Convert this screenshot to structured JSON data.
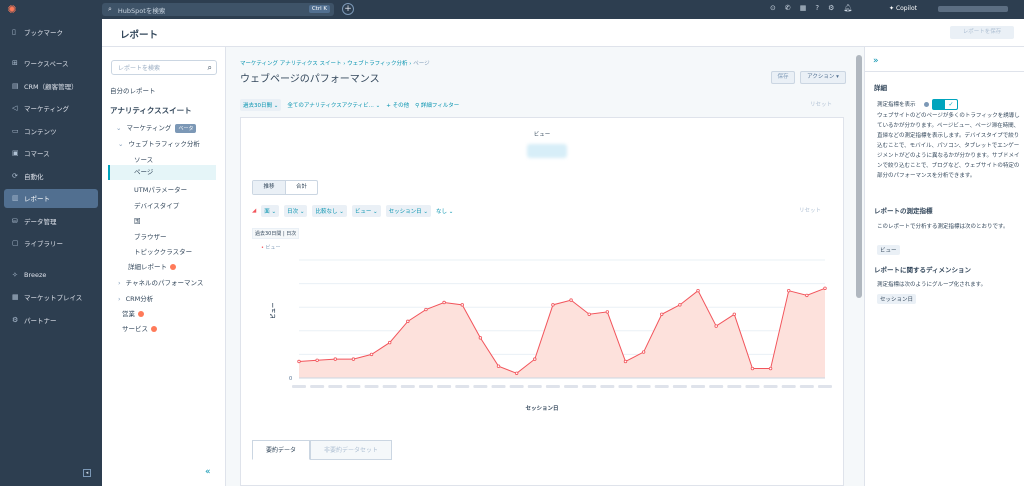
{
  "topbar": {
    "search_placeholder": "HubSpotを検索",
    "shortcut": "Ctrl K",
    "copilot": "Copilot"
  },
  "leftnav": {
    "items": [
      {
        "label": "ブックマーク",
        "icon": "bookmark-icon"
      },
      {
        "label": "ワークスペース",
        "icon": "grid-icon"
      },
      {
        "label": "CRM（顧客管理）",
        "icon": "crm-icon"
      },
      {
        "label": "マーケティング",
        "icon": "megaphone-icon"
      },
      {
        "label": "コンテンツ",
        "icon": "content-icon"
      },
      {
        "label": "コマース",
        "icon": "commerce-icon"
      },
      {
        "label": "自動化",
        "icon": "automation-icon"
      },
      {
        "label": "レポート",
        "icon": "report-icon"
      },
      {
        "label": "データ管理",
        "icon": "database-icon"
      },
      {
        "label": "ライブラリー",
        "icon": "library-icon"
      },
      {
        "label": "Breeze",
        "icon": "breeze-icon"
      },
      {
        "label": "マーケットプレイス",
        "icon": "marketplace-icon"
      },
      {
        "label": "パートナー",
        "icon": "partner-icon"
      }
    ]
  },
  "header": {
    "title": "レポート",
    "save_button": "レポートを保存"
  },
  "subnav": {
    "search_placeholder": "レポートを検索",
    "my_reports": "自分のレポート",
    "analytics_suite": "アナリティクススイート",
    "marketing": "マーケティング",
    "beta": "ベータ",
    "web_traffic": "ウェブトラフィック分析",
    "source": "ソース",
    "page": "ページ",
    "utm": "UTMパラメーター",
    "device_type": "デバイスタイプ",
    "country": "国",
    "browser": "ブラウザー",
    "topic_cluster": "トピッククラスター",
    "detailed_report": "詳細レポート",
    "channel_performance": "チャネルのパフォーマンス",
    "crm_analysis": "CRM分析",
    "sales": "営業",
    "service": "サービス"
  },
  "main": {
    "breadcrumb": [
      "マーケティング アナリティクス スイート",
      "ウェブトラフィック分析",
      "ページ"
    ],
    "title": "ウェブページのパフォーマンス",
    "save": "保存",
    "actions": "アクション ▾",
    "filters": {
      "date": "過去30日間 ⌄",
      "activity": "全てのアナリティクスアクティビ...  ⌄",
      "other": "+ その他",
      "advanced": "⚲ 詳細フィルター",
      "reset": "リセット"
    },
    "kpi_label": "ビュー",
    "toggle": [
      "推移",
      "合計"
    ],
    "chart_filters": {
      "chart_type": "面 ⌄",
      "interval": "日次 ⌄",
      "compare": "比較なし ⌄",
      "metric": "ビュー ⌄",
      "dimension": "セッション日 ⌄",
      "none": "なし ⌄",
      "reset": "リセット"
    },
    "date_tag": "過去30日間 | 日次",
    "tabs": [
      "要約データ",
      "非要約データセット"
    ]
  },
  "chart_data": {
    "type": "area",
    "series": [
      {
        "name": "ビュー",
        "values": [
          7,
          7.5,
          8,
          8,
          10,
          15,
          24,
          29,
          32,
          31,
          17,
          5,
          2,
          8,
          31,
          33,
          27,
          28,
          7,
          11,
          27,
          31,
          37,
          22,
          27,
          4,
          4,
          37,
          35,
          38
        ]
      }
    ],
    "xlabel": "セッション日",
    "ylabel": "ビュー",
    "ylim": [
      0,
      50
    ],
    "yticks": [
      "0"
    ],
    "color": "#f2545b",
    "fill": "#fde1dc",
    "grid": true
  },
  "rpanel": {
    "section": "詳細",
    "show_metrics": "測定指標を表示",
    "description": "ウェブサイトのどのページが多くのトラフィックを誘導しているかが分かります。ページビュー、ページ滞在時間、直帰などの測定指標を表示します。デバイスタイプで絞り込むことで、モバイル、パソコン、タブレットでエンゲージメントがどのように異なるかが分かります。サブドメインで絞り込むことで、ブログなど、ウェブサイトの特定の部分のパフォーマンスを分析できます。",
    "metrics_title": "レポートの測定指標",
    "metrics_text": "このレポートで分析する測定指標は次のとおりです。",
    "metric_tag": "ビュー",
    "dimensions_title": "レポートに関するディメンション",
    "dimensions_text": "測定指標は次のようにグループ化されます。",
    "dimension_tag": "セッション日"
  }
}
